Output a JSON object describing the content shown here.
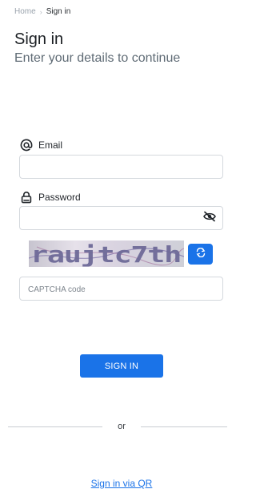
{
  "breadcrumb": {
    "home": "Home",
    "separator": "›",
    "current": "Sign in"
  },
  "header": {
    "title": "Sign in",
    "subtitle": "Enter your details to continue"
  },
  "form": {
    "email_label": "Email",
    "email_value": "",
    "password_label": "Password",
    "password_value": "",
    "captcha_text": "raujtc7th",
    "captcha_placeholder": "CAPTCHA code",
    "submit_label": "SIGN IN"
  },
  "divider": {
    "text": "or"
  },
  "links": {
    "qr": "Sign in via QR"
  },
  "icons": {
    "email": "at-icon",
    "password": "lock-icon",
    "visibility": "eye-slash-icon",
    "refresh": "refresh-icon"
  },
  "colors": {
    "primary": "#1a73e8",
    "muted": "#5f6b75",
    "border": "#d4d8dd"
  }
}
